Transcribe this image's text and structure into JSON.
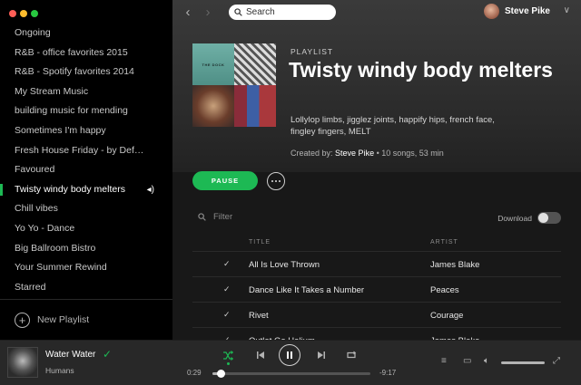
{
  "colors": {
    "accent": "#1db954",
    "sidebar_bg": "#000000",
    "main_bg": "#181818",
    "player_bg": "#282828"
  },
  "sidebar": {
    "playlists": [
      {
        "label": "Ongoing",
        "active": false
      },
      {
        "label": "R&B - office favorites 2015",
        "active": false
      },
      {
        "label": "R&B - Spotify favorites 2014",
        "active": false
      },
      {
        "label": "My Stream Music",
        "active": false
      },
      {
        "label": "building music for mending",
        "active": false
      },
      {
        "label": "Sometimes I'm happy",
        "active": false
      },
      {
        "label": "Fresh House Friday - by Defected",
        "active": false
      },
      {
        "label": "Favoured",
        "active": false
      },
      {
        "label": "Twisty windy body melters",
        "active": true
      },
      {
        "label": "Chill vibes",
        "active": false
      },
      {
        "label": "Yo Yo - Dance",
        "active": false
      },
      {
        "label": "Big Ballroom Bistro",
        "active": false
      },
      {
        "label": "Your Summer Rewind",
        "active": false
      },
      {
        "label": "Starred",
        "active": false
      }
    ],
    "now_playing_icon": "speaker-icon",
    "new_playlist_label": "New Playlist"
  },
  "topbar": {
    "search_placeholder": "Search",
    "user_name": "Steve Pike"
  },
  "playlist": {
    "type_label": "PLAYLIST",
    "title": "Twisty windy body melters",
    "description": "Lollylop limbs, jigglez joints, happify hips, french face, fingley fingers, MELT",
    "created_by_label": "Created by:",
    "owner": "Steve Pike",
    "stats": "• 10 songs, 53 min",
    "cover_text": "THE DOCK",
    "pause_label": "PAUSE",
    "filter_placeholder": "Filter",
    "download_label": "Download",
    "download_on": false
  },
  "tracks": {
    "columns": {
      "title": "TITLE",
      "artist": "ARTIST"
    },
    "rows": [
      {
        "title": "All Is Love Thrown",
        "artist": "James Blake"
      },
      {
        "title": "Dance Like It Takes a Number",
        "artist": "Peaces"
      },
      {
        "title": "Rivet",
        "artist": "Courage"
      },
      {
        "title": "Outlet Go Helium",
        "artist": "James Blake"
      }
    ]
  },
  "player": {
    "track_title": "Water Water",
    "track_artist": "Humans",
    "saved": true,
    "shuffle_on": true,
    "elapsed": "0:29",
    "remaining": "-9:17",
    "progress_fraction": 0.05,
    "volume_fraction": 1.0
  }
}
